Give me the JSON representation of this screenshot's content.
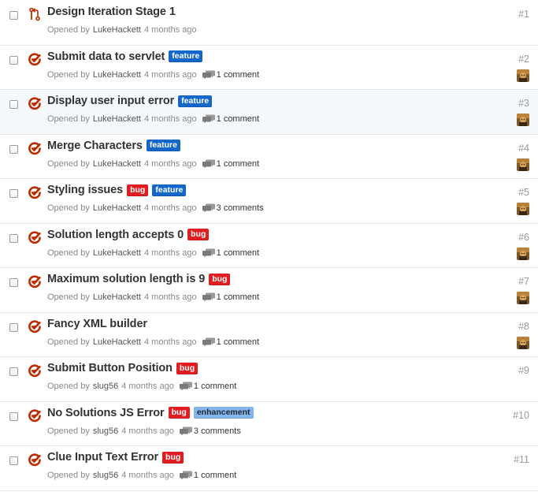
{
  "issues": [
    {
      "type": "pr",
      "title": "Design Iteration Stage 1",
      "labels": [],
      "opened_prefix": "Opened by",
      "author": "LukeHackett",
      "age": "4 months ago",
      "comments": "",
      "number": "#1",
      "avatar": false
    },
    {
      "type": "issue",
      "title": "Submit data to servlet",
      "labels": [
        {
          "text": "feature",
          "kind": "feature"
        }
      ],
      "opened_prefix": "Opened by",
      "author": "LukeHackett",
      "age": "4 months ago",
      "comments": "1 comment",
      "number": "#2",
      "avatar": true
    },
    {
      "type": "issue",
      "title": "Display user input error",
      "labels": [
        {
          "text": "feature",
          "kind": "feature"
        }
      ],
      "opened_prefix": "Opened by",
      "author": "LukeHackett",
      "age": "4 months ago",
      "comments": "1 comment",
      "number": "#3",
      "avatar": true
    },
    {
      "type": "issue",
      "title": "Merge Characters",
      "labels": [
        {
          "text": "feature",
          "kind": "feature"
        }
      ],
      "opened_prefix": "Opened by",
      "author": "LukeHackett",
      "age": "4 months ago",
      "comments": "1 comment",
      "number": "#4",
      "avatar": true
    },
    {
      "type": "issue",
      "title": "Styling issues",
      "labels": [
        {
          "text": "bug",
          "kind": "bug"
        },
        {
          "text": "feature",
          "kind": "feature"
        }
      ],
      "opened_prefix": "Opened by",
      "author": "LukeHackett",
      "age": "4 months ago",
      "comments": "3 comments",
      "number": "#5",
      "avatar": true
    },
    {
      "type": "issue",
      "title": "Solution length accepts 0",
      "labels": [
        {
          "text": "bug",
          "kind": "bug"
        }
      ],
      "opened_prefix": "Opened by",
      "author": "LukeHackett",
      "age": "4 months ago",
      "comments": "1 comment",
      "number": "#6",
      "avatar": true
    },
    {
      "type": "issue",
      "title": "Maximum solution length is 9",
      "labels": [
        {
          "text": "bug",
          "kind": "bug"
        }
      ],
      "opened_prefix": "Opened by",
      "author": "LukeHackett",
      "age": "4 months ago",
      "comments": "1 comment",
      "number": "#7",
      "avatar": true
    },
    {
      "type": "issue",
      "title": "Fancy XML builder",
      "labels": [],
      "opened_prefix": "Opened by",
      "author": "LukeHackett",
      "age": "4 months ago",
      "comments": "1 comment",
      "number": "#8",
      "avatar": true
    },
    {
      "type": "issue",
      "title": "Submit Button Position",
      "labels": [
        {
          "text": "bug",
          "kind": "bug"
        }
      ],
      "opened_prefix": "Opened by",
      "author": "slug56",
      "age": "4 months ago",
      "comments": "1 comment",
      "number": "#9",
      "avatar": false
    },
    {
      "type": "issue",
      "title": "No Solutions JS Error",
      "labels": [
        {
          "text": "bug",
          "kind": "bug"
        },
        {
          "text": "enhancement",
          "kind": "enhancement"
        }
      ],
      "opened_prefix": "Opened by",
      "author": "slug56",
      "age": "4 months ago",
      "comments": "3 comments",
      "number": "#10",
      "avatar": false
    },
    {
      "type": "issue",
      "title": "Clue Input Text Error",
      "labels": [
        {
          "text": "bug",
          "kind": "bug"
        }
      ],
      "opened_prefix": "Opened by",
      "author": "slug56",
      "age": "4 months ago",
      "comments": "1 comment",
      "number": "#11",
      "avatar": false
    }
  ],
  "colors": {
    "closed_icon": "#bd2c00",
    "label_feature": "#1466c9",
    "label_bug": "#e11d21",
    "label_enhancement": "#84b6eb"
  },
  "icons": {
    "pr": "git-pull-request-icon",
    "issue": "issue-closed-icon",
    "comment": "comment-bubbles-icon"
  }
}
